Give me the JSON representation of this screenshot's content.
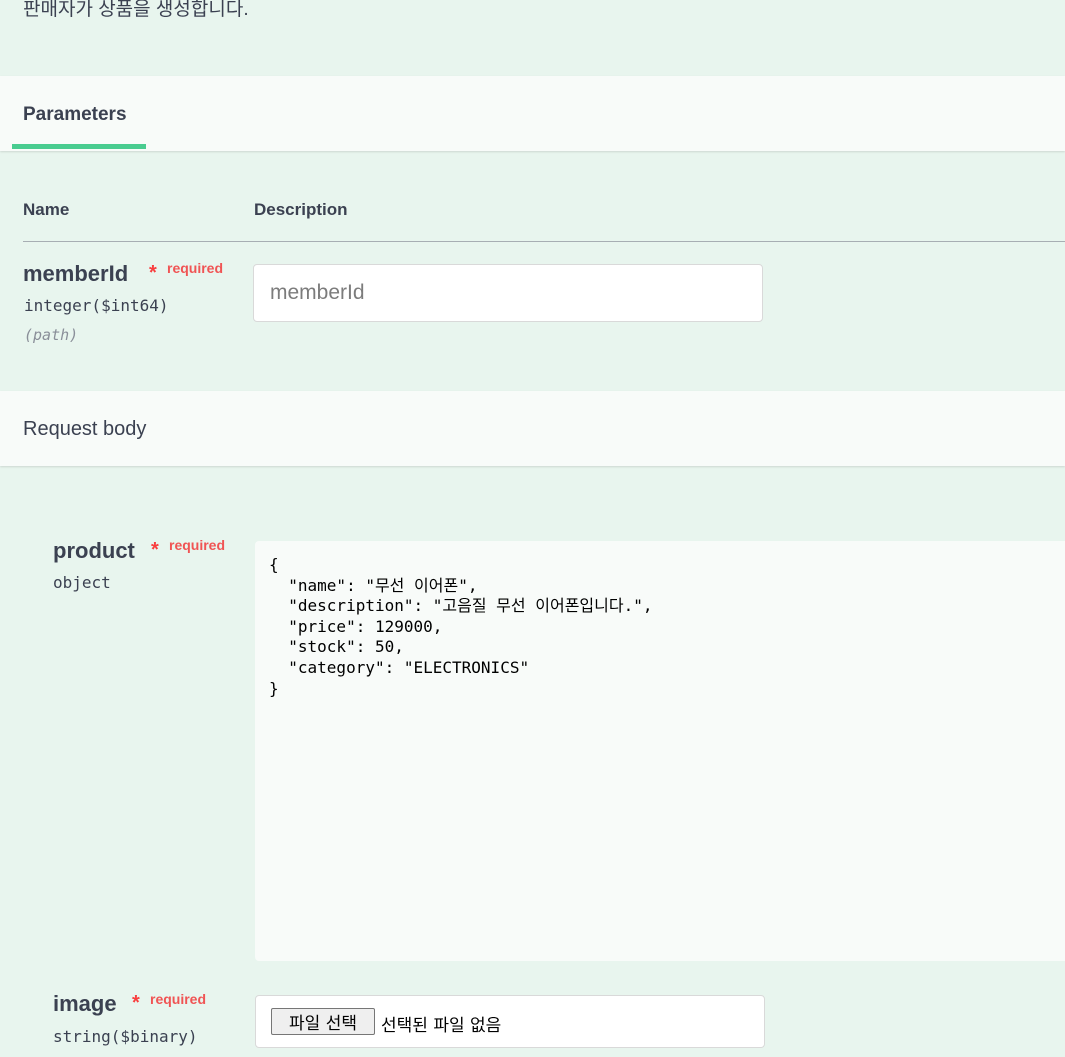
{
  "operation": {
    "summary": "판매자가 상품을 생성합니다."
  },
  "tabs": {
    "parameters_label": "Parameters"
  },
  "table_headers": {
    "name": "Name",
    "description": "Description"
  },
  "parameters": [
    {
      "name": "memberId",
      "required_star": "*",
      "required_label": "required",
      "type": "integer($int64)",
      "in": "(path)",
      "placeholder": "memberId",
      "value": ""
    }
  ],
  "request_body": {
    "label": "Request body",
    "fields": [
      {
        "name": "product",
        "required_star": "*",
        "required_label": "required",
        "type": "object",
        "value": "{\n  \"name\": \"무선 이어폰\",\n  \"description\": \"고음질 무선 이어폰입니다.\",\n  \"price\": 129000,\n  \"stock\": 50,\n  \"category\": \"ELECTRONICS\"\n}"
      },
      {
        "name": "image",
        "required_star": "*",
        "required_label": "required",
        "type": "string($binary)",
        "file_button_label": "파일 선택",
        "file_status": "선택된 파일 없음"
      }
    ]
  },
  "colors": {
    "background": "#e8f5ee",
    "accent": "#49cc90",
    "required": "#f93e3e"
  }
}
